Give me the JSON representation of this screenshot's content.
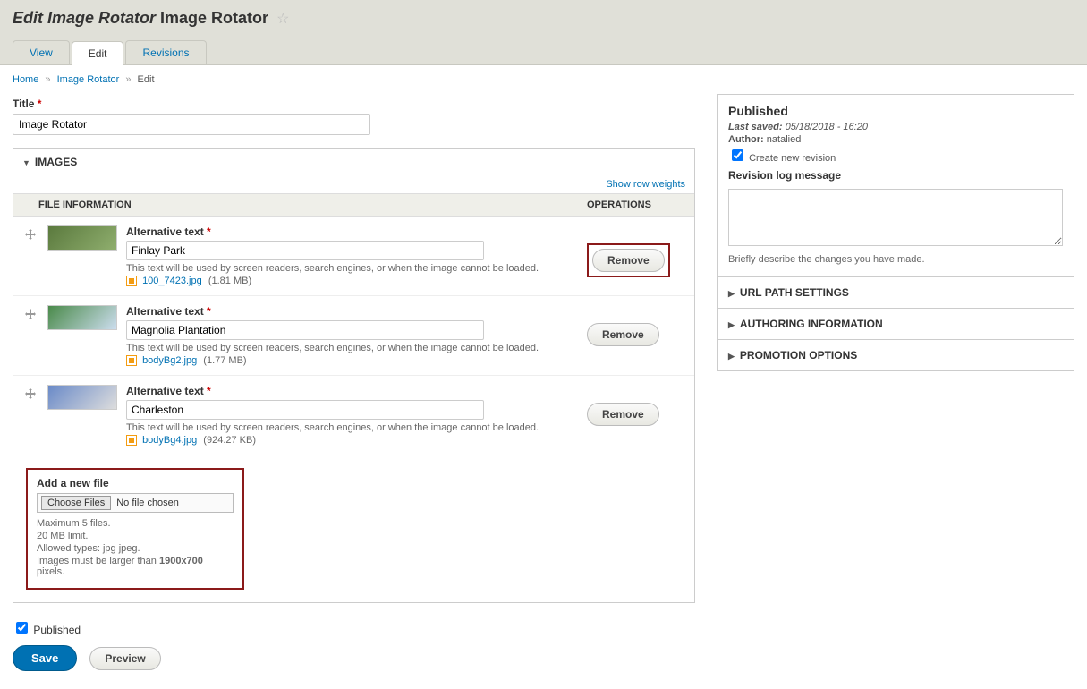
{
  "header": {
    "title_italic": "Edit Image Rotator",
    "title_normal": "Image Rotator"
  },
  "tabs": [
    {
      "label": "View",
      "active": false
    },
    {
      "label": "Edit",
      "active": true
    },
    {
      "label": "Revisions",
      "active": false
    }
  ],
  "breadcrumb": {
    "home": "Home",
    "image_rotator": "Image Rotator",
    "current": "Edit"
  },
  "title_field": {
    "label": "Title",
    "value": "Image Rotator"
  },
  "images_legend": "IMAGES",
  "show_row_weights": "Show row weights",
  "columns": {
    "info": "FILE INFORMATION",
    "ops": "OPERATIONS"
  },
  "alt_label": "Alternative text",
  "alt_help": "This text will be used by screen readers, search engines, or when the image cannot be loaded.",
  "remove_label": "Remove",
  "rows": [
    {
      "alt": "Finlay Park",
      "file": "100_7423.jpg",
      "size": "(1.81 MB)",
      "highlight": true
    },
    {
      "alt": "Magnolia Plantation",
      "file": "bodyBg2.jpg",
      "size": "(1.77 MB)",
      "highlight": false
    },
    {
      "alt": "Charleston",
      "file": "bodyBg4.jpg",
      "size": "(924.27 KB)",
      "highlight": false
    }
  ],
  "add_file": {
    "label": "Add a new file",
    "choose": "Choose Files",
    "nofile": "No file chosen",
    "line1": "Maximum 5 files.",
    "line2": "20 MB limit.",
    "line3": "Allowed types: jpg jpeg.",
    "line4a": "Images must be larger than ",
    "line4b": "1900x700",
    "line4c": " pixels."
  },
  "published_checkbox": "Published",
  "save_label": "Save",
  "preview_label": "Preview",
  "sidebar": {
    "published": "Published",
    "last_saved_label": "Last saved:",
    "last_saved_value": "05/18/2018 - 16:20",
    "author_label": "Author:",
    "author_value": "natalied",
    "create_rev": "Create new revision",
    "log_label": "Revision log message",
    "log_help": "Briefly describe the changes you have made.",
    "url_path": "URL PATH SETTINGS",
    "authoring": "AUTHORING INFORMATION",
    "promotion": "PROMOTION OPTIONS"
  }
}
